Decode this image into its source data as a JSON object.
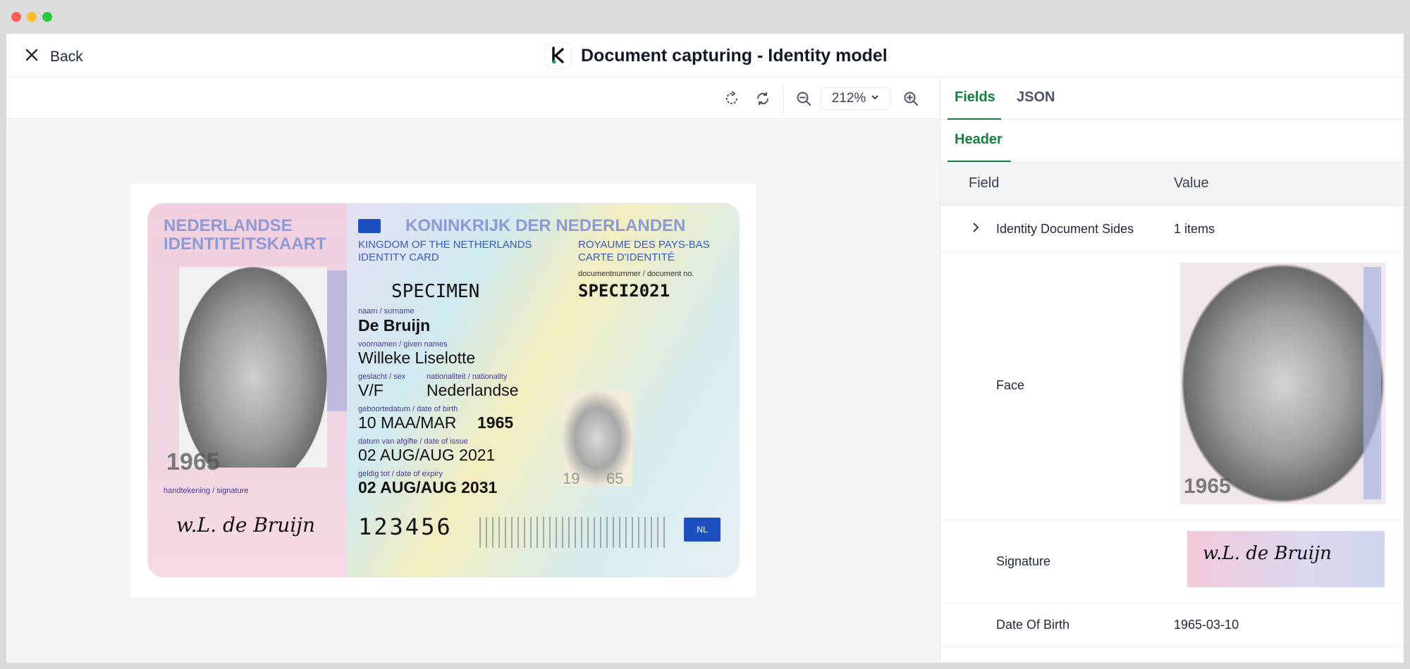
{
  "window": {
    "title": "Document capturing - Identity model"
  },
  "topbar": {
    "back_label": "Back"
  },
  "toolbar": {
    "zoom_value": "212%"
  },
  "panel": {
    "tabs": [
      {
        "label": "Fields"
      },
      {
        "label": "JSON"
      }
    ],
    "subtab": "Header",
    "table": {
      "columns": [
        "Field",
        "Value"
      ],
      "rows": [
        {
          "field": "Identity Document Sides",
          "value": "1 items"
        },
        {
          "field": "Face",
          "value": ""
        },
        {
          "field": "Signature",
          "value": ""
        },
        {
          "field": "Date Of Birth",
          "value": "1965-03-10"
        }
      ]
    }
  },
  "card": {
    "header_nl_1": "NEDERLANDSE",
    "header_nl_2": "IDENTITEITSKAART",
    "kingdom": "KONINKRIJK DER NEDERLANDEN",
    "kingdom_en_1": "KINGDOM OF THE NETHERLANDS",
    "kingdom_en_2": "IDENTITY CARD",
    "kingdom_fr_1": "ROYAUME DES PAYS-BAS",
    "kingdom_fr_2": "CARTE D'IDENTITÉ",
    "docnum_label": "documentnummer / document no.",
    "specimen": "SPECIMEN",
    "docnum": "SPECI2021",
    "surname_label": "naam / surname",
    "surname": "De Bruijn",
    "given_label": "voornamen / given names",
    "given": "Willeke Liselotte",
    "sex_label": "geslacht / sex",
    "nationality_label": "nationaliteit / nationality",
    "sex": "V/F",
    "nationality": "Nederlandse",
    "dob_label": "geboortedatum / date of birth",
    "dob": "10 MAA/MAR",
    "dob_year": "1965",
    "issue_label": "datum van afgifte / date of issue",
    "issue": "02 AUG/AUG 2021",
    "expiry_label": "geldig tot / date of expiry",
    "expiry": "02 AUG/AUG 2031",
    "signature_label": "handtekening / signature",
    "signature": "w.L. de Bruijn",
    "card_number": "123456",
    "portrait_year": "1965",
    "mini_year_1": "19",
    "mini_year_2": "65",
    "flag": "NL"
  },
  "colors": {
    "accent": "#15803d",
    "text": "#1f2937"
  }
}
